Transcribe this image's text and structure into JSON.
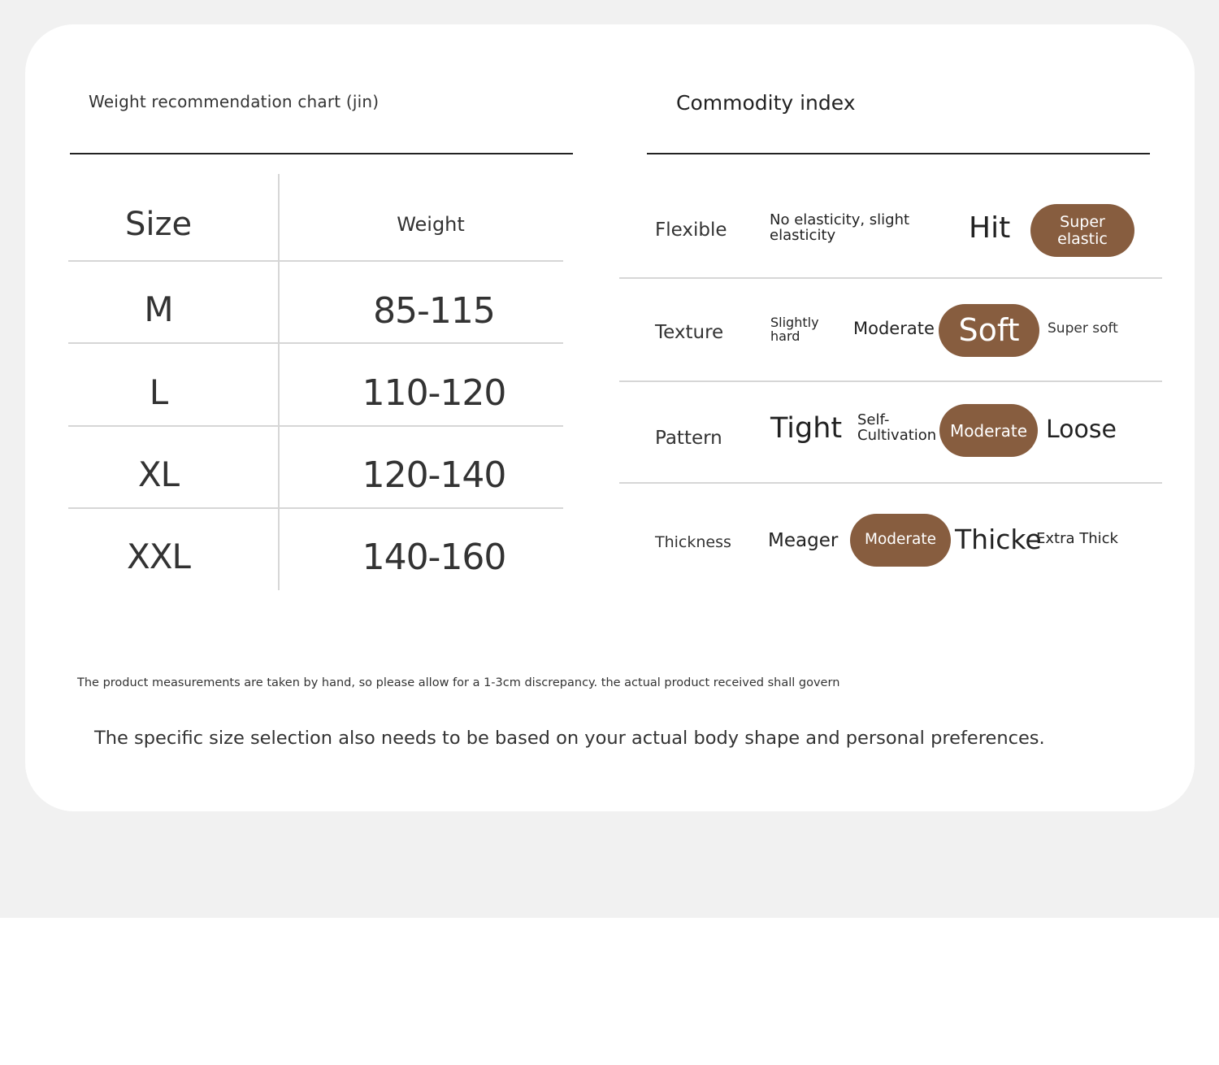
{
  "colors": {
    "accent": "#875d3f",
    "background": "#f1f1f1",
    "card": "#ffffff",
    "rule": "#222222",
    "grid": "#d6d6d6"
  },
  "size_chart": {
    "title": "Weight recommendation chart (jin)",
    "headers": {
      "size": "Size",
      "weight": "Weight"
    },
    "rows": [
      {
        "size": "M",
        "weight": "85-115"
      },
      {
        "size": "L",
        "weight": "110-120"
      },
      {
        "size": "XL",
        "weight": "120-140"
      },
      {
        "size": "XXL",
        "weight": "140-160"
      }
    ]
  },
  "commodity_index": {
    "title": "Commodity index",
    "rows": [
      {
        "label": "Flexible",
        "options": [
          "No elasticity, slight elasticity",
          "Hit",
          "Super elastic"
        ],
        "selected": "Super elastic"
      },
      {
        "label": "Texture",
        "options": [
          "Slightly hard",
          "Moderate",
          "Soft",
          "Super soft"
        ],
        "selected": "Soft"
      },
      {
        "label": "Pattern",
        "options": [
          "Tight",
          "Self-Cultivation",
          "Moderate",
          "Loose"
        ],
        "selected": "Moderate"
      },
      {
        "label": "Thickness",
        "options": [
          "Meager",
          "Moderate",
          "Thicke",
          "Extra Thick"
        ],
        "selected": "Moderate"
      }
    ]
  },
  "notes": {
    "measurement": "The product measurements are taken by hand, so please allow for a 1-3cm discrepancy. the actual product received shall govern",
    "selection": "The specific size selection also needs to be based on your actual body shape and personal preferences."
  }
}
